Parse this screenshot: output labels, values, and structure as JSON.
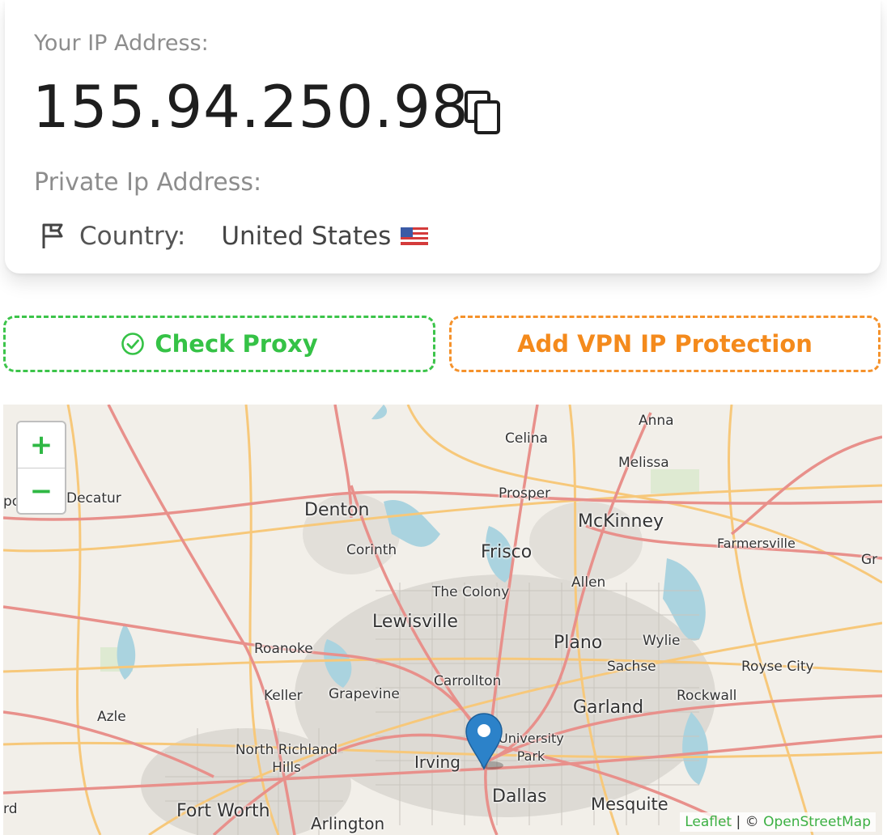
{
  "ip_card": {
    "ip_label": "Your IP Address:",
    "ip_value": "155.94.250.98",
    "copy_icon": "copy-icon",
    "private_label": "Private Ip Address:",
    "country_icon": "flag-outline-icon",
    "country_label": "Country:",
    "country_value": "United States",
    "country_flag": "us-flag"
  },
  "actions": {
    "check_proxy": "Check Proxy",
    "check_icon": "circle-check-icon",
    "add_vpn": "Add VPN IP Protection"
  },
  "colors": {
    "green": "#35c246",
    "orange": "#f48a1c",
    "marker": "#2c82c9"
  },
  "map": {
    "zoom_in": "+",
    "zoom_out": "−",
    "places": [
      "Anna",
      "Celina",
      "Melissa",
      "Decatur",
      "Prosper",
      "Denton",
      "McKinney",
      "Farmersville",
      "Corinth",
      "Frisco",
      "Gr",
      "Allen",
      "The Colony",
      "Lewisville",
      "Plano",
      "Wylie",
      "Roanoke",
      "Sachse",
      "Royse City",
      "Carrollton",
      "Keller",
      "Grapevine",
      "Rockwall",
      "Garland",
      "Azle",
      "University Park",
      "North Richland Hills",
      "Irving",
      "Dallas",
      "Mesquite",
      "Fort Worth",
      "Arlington",
      "rd",
      "port"
    ],
    "attribution_leaflet": "Leaflet",
    "attribution_sep": " | © ",
    "attribution_osm": "OpenStreetMap"
  }
}
